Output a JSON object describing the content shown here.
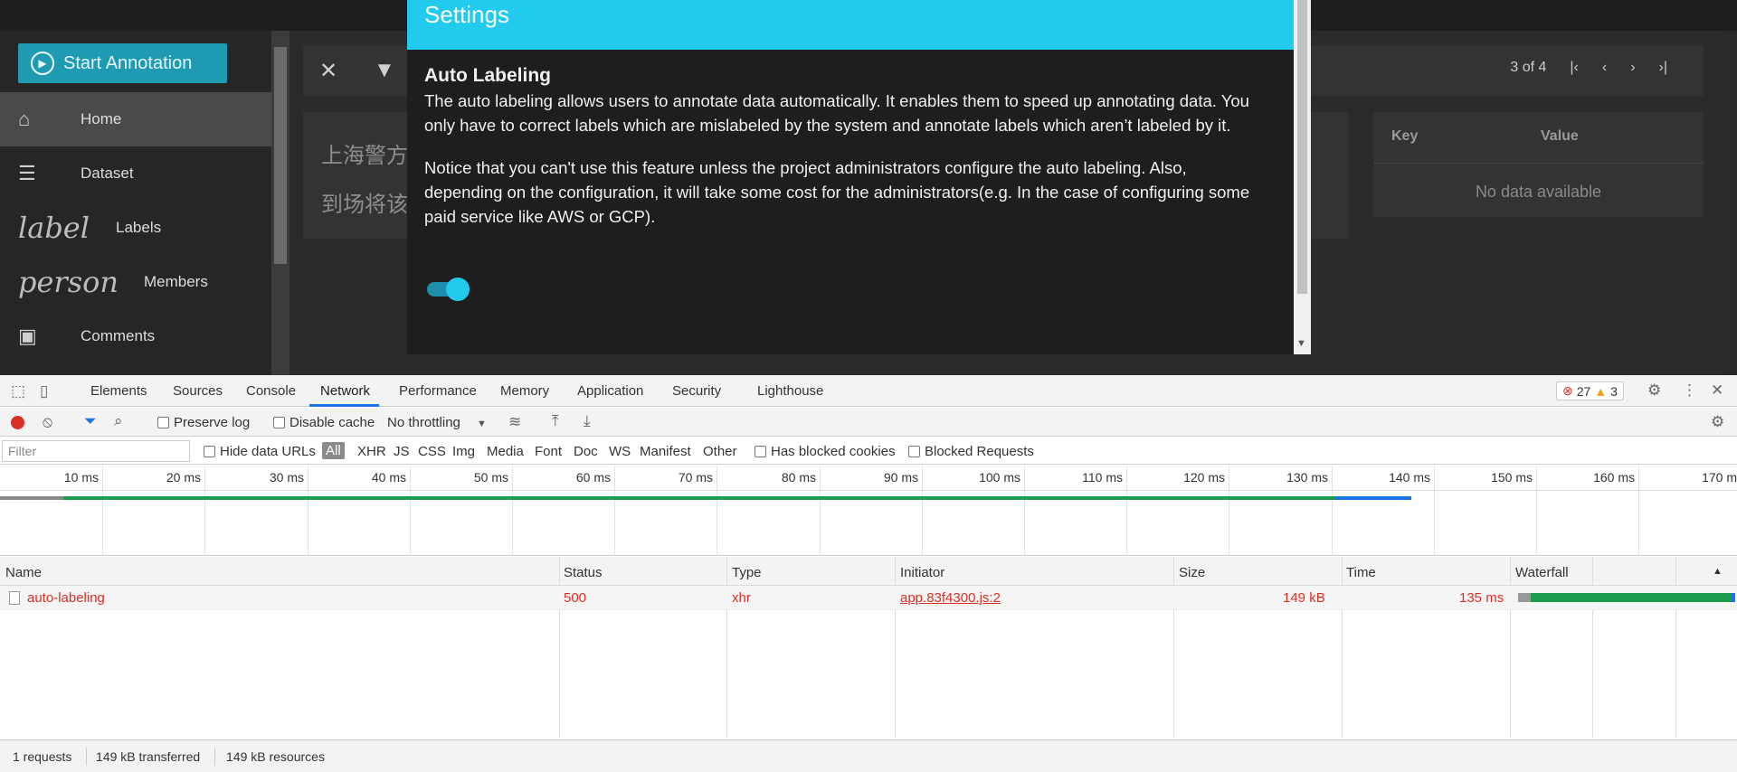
{
  "app": {
    "start_button_label": "Start Annotation",
    "sidebar": [
      {
        "label": "Home",
        "icon": "home-icon",
        "active": true
      },
      {
        "label": "Dataset",
        "icon": "database-icon",
        "active": false
      },
      {
        "label": "Labels",
        "icon_text": "label",
        "active": false
      },
      {
        "label": "Members",
        "icon_text": "person",
        "active": false
      },
      {
        "label": "Comments",
        "icon": "comment-icon",
        "active": false
      }
    ],
    "pager": {
      "text": "3 of 4"
    },
    "text_lines": [
      "上海警方",
      "到场将该"
    ],
    "metadata": {
      "key_header": "Key",
      "value_header": "Value",
      "empty_text": "No data available"
    }
  },
  "dialog": {
    "title": "Settings",
    "section_title": "Auto Labeling",
    "para1": "The auto labeling allows users to annotate data automatically. It enables them to speed up annotating data. You only have to correct labels which are mislabeled by the system and annotate labels which aren’t labeled by it.",
    "para2": "Notice that you can't use this feature unless the project administrators configure the auto labeling. Also, depending on the configuration, it will take some cost for the administrators(e.g. In the case of configuring some paid service like AWS or GCP).",
    "toggle_on": true,
    "accent_color": "#22cbee"
  },
  "devtools": {
    "tabs": [
      "Elements",
      "Sources",
      "Console",
      "Network",
      "Performance",
      "Memory",
      "Application",
      "Security",
      "Lighthouse"
    ],
    "active_tab": "Network",
    "errors": "27",
    "warnings": "3",
    "preserve_log": "Preserve log",
    "disable_cache": "Disable cache",
    "throttling": "No throttling",
    "filter_placeholder": "Filter",
    "hide_data_urls": "Hide data URLs",
    "types": [
      "All",
      "XHR",
      "JS",
      "CSS",
      "Img",
      "Media",
      "Font",
      "Doc",
      "WS",
      "Manifest",
      "Other"
    ],
    "has_blocked_cookies": "Has blocked cookies",
    "blocked_requests": "Blocked Requests",
    "timeline_ticks": [
      "10 ms",
      "20 ms",
      "30 ms",
      "40 ms",
      "50 ms",
      "60 ms",
      "70 ms",
      "80 ms",
      "90 ms",
      "100 ms",
      "110 ms",
      "120 ms",
      "130 ms",
      "140 ms",
      "150 ms",
      "160 ms",
      "170 m"
    ],
    "columns": [
      "Name",
      "Status",
      "Type",
      "Initiator",
      "Size",
      "Time",
      "Waterfall"
    ],
    "rows": [
      {
        "name": "auto-labeling",
        "status": "500",
        "type": "xhr",
        "initiator": "app.83f4300.js:2",
        "size": "149 kB",
        "time": "135 ms"
      }
    ],
    "summary": {
      "requests": "1 requests",
      "transferred": "149 kB transferred",
      "resources": "149 kB resources"
    }
  }
}
